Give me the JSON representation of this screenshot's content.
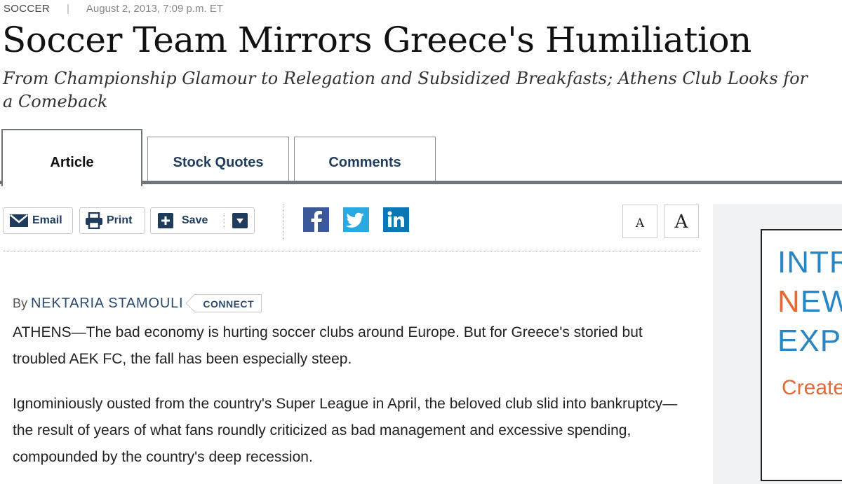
{
  "header": {
    "section": "SOCCER",
    "separator": "|",
    "timestamp": "August 2, 2013, 7:09 p.m. ET",
    "headline": "Soccer Team Mirrors Greece's Humiliation",
    "dek": "From Championship Glamour to Relegation and Subsidized Breakfasts; Athens Club Looks for a Comeback"
  },
  "tabs": [
    {
      "label": "Article",
      "active": true
    },
    {
      "label": "Stock Quotes",
      "active": false
    },
    {
      "label": "Comments",
      "active": false
    }
  ],
  "toolbar": {
    "email_label": "Email",
    "print_label": "Print",
    "save_label": "Save",
    "social": [
      "facebook-icon",
      "twitter-icon",
      "linkedin-icon"
    ],
    "font_small": "A",
    "font_large": "A"
  },
  "byline": {
    "by": "By",
    "author": "NEKTARIA STAMOULI",
    "connect": "CONNECT"
  },
  "article": {
    "paragraphs": [
      "ATHENS—The bad economy is hurting soccer clubs around Europe. But for Greece's storied but troubled AEK FC, the fall has been especially steep.",
      "Ignominiously ousted from the country's Super League in April, the beloved club slid into bankruptcy—the result of years of what fans roundly criticized as bad management and excessive spending, compounded by the country's deep recession."
    ]
  },
  "ad": {
    "line1": "INTR",
    "line2_highlight": "N",
    "line2_rest": "EW",
    "line3": "EXP",
    "cta": "Create"
  },
  "colors": {
    "link_blue": "#1f3c5c",
    "tab_rule": "#6f7478",
    "facebook": "#3b5998",
    "twitter": "#2aa9e0",
    "linkedin": "#0b76b3",
    "ad_blue": "#2a86c2",
    "ad_orange": "#e46a33"
  }
}
